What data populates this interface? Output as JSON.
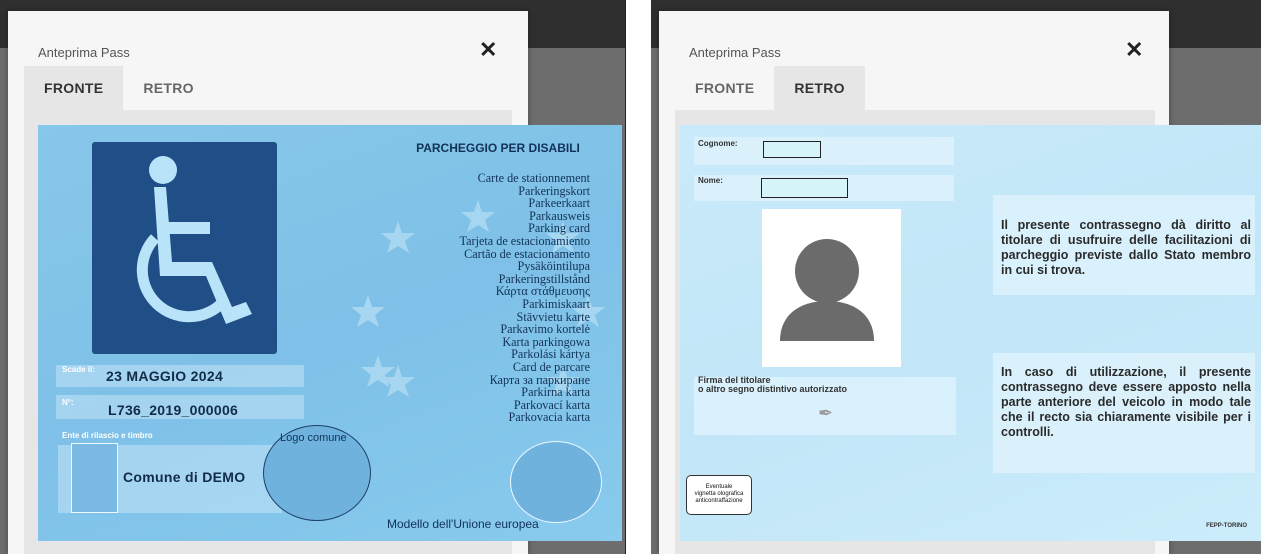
{
  "colors": {
    "card_front": "#7ec0e7",
    "card_back": "#c2e6f8",
    "symbol_bg": "#1f4f86",
    "tab_active": "#e6e6e6"
  },
  "left_modal": {
    "title": "Anteprima Pass",
    "close_icon": "close-icon",
    "tabs": [
      {
        "label": "FRONTE",
        "active": true
      },
      {
        "label": "RETRO",
        "active": false
      }
    ]
  },
  "right_modal": {
    "title": "Anteprima Pass",
    "close_icon": "close-icon",
    "tabs": [
      {
        "label": "FRONTE",
        "active": false
      },
      {
        "label": "RETRO",
        "active": true
      }
    ]
  },
  "front": {
    "title": "PARCHEGGIO PER DISABILI",
    "languages": [
      "Carte de stationnement",
      "Parkeringskort",
      "Parkeerkaart",
      "Parkausweis",
      "Parking card",
      "Tarjeta de estacionamiento",
      "Cartão de estacionamento",
      "Pysäköintilupa",
      "Parkeringstillstånd",
      "Κάρτα στάθμευσης",
      "Parkimiskaart",
      "Stāvvietu karte",
      "Parkavimo kortelė",
      "Karta parkingowa",
      "Parkolási kártya",
      "Card de parcare",
      "Карта за паркиране",
      "Parkirna karta",
      "Parkovací karta",
      "Parkovacia karta"
    ],
    "scade_label": "Scade il:",
    "scade_value": "23 MAGGIO 2024",
    "num_label": "N°:",
    "num_value": "L736_2019_000006",
    "ente_label": "Ente di rilascio e timbro",
    "comune": "Comune di DEMO",
    "logo_label": "Logo comune",
    "footer": "Modello dell'Unione europea"
  },
  "back": {
    "cognome_label": "Cognome:",
    "nome_label": "Nome:",
    "text1": "Il presente contrassegno dà diritto al titolare di usufruire delle facilitazioni di parcheggio previste dallo Stato membro in cui si trova.",
    "text2": "In caso di utilizzazione, il presente contrassegno deve essere apposto nella parte anteriore del veicolo in modo tale che il recto sia chiaramente visibile per i controlli.",
    "firma_label_1": "Firma del titolare",
    "firma_label_2": "o altro segno distintivo autorizzato",
    "holo_1": "Eventuale",
    "holo_2": "vignetta olografica",
    "holo_3": "anticontraffazione",
    "fepp": "FEPP-TORINO"
  }
}
